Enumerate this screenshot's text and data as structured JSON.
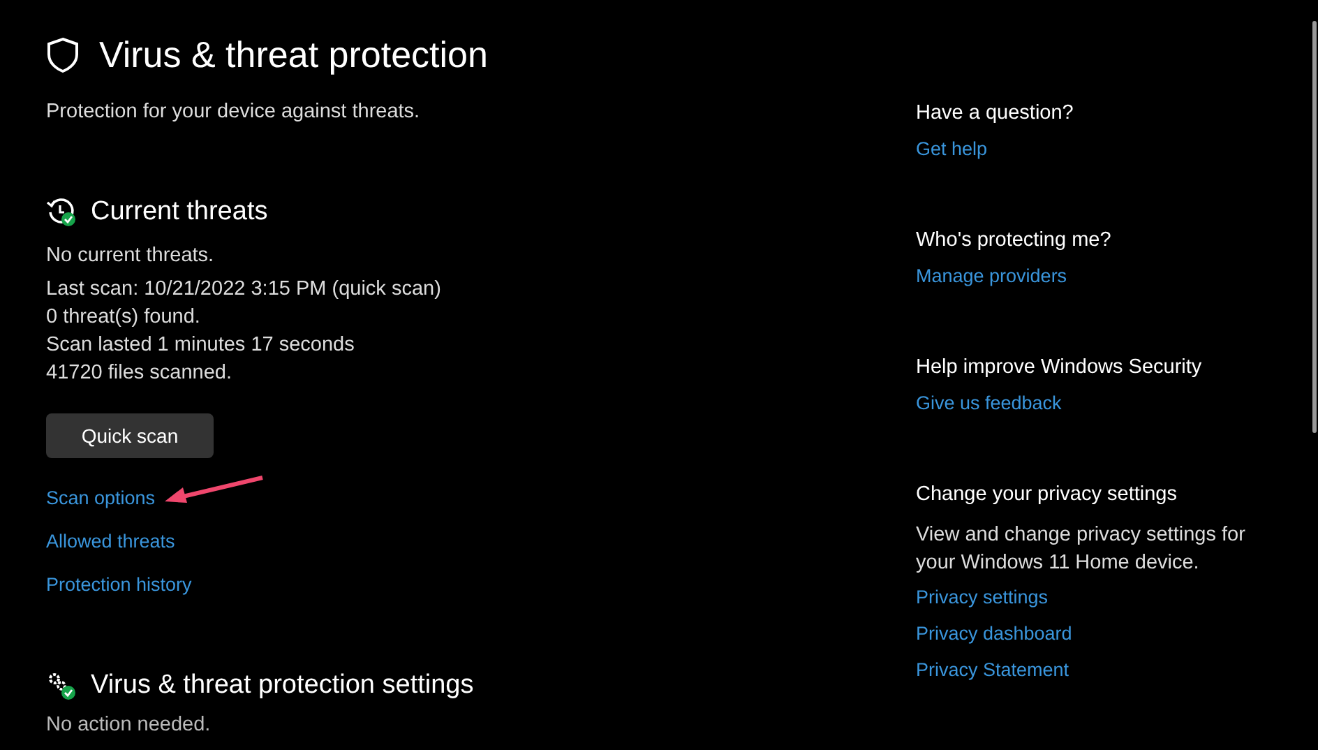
{
  "page": {
    "title": "Virus & threat protection",
    "subtitle": "Protection for your device against threats."
  },
  "current_threats": {
    "heading": "Current threats",
    "lines": [
      "No current threats.",
      "Last scan: 10/21/2022 3:15 PM (quick scan)",
      "0 threat(s) found.",
      "Scan lasted 1 minutes 17 seconds",
      "41720 files scanned."
    ],
    "button": "Quick scan",
    "links": [
      "Scan options",
      "Allowed threats",
      "Protection history"
    ]
  },
  "settings": {
    "heading": "Virus & threat protection settings",
    "status": "No action needed."
  },
  "sidebar": [
    {
      "heading": "Have a question?",
      "links": [
        "Get help"
      ]
    },
    {
      "heading": "Who's protecting me?",
      "links": [
        "Manage providers"
      ]
    },
    {
      "heading": "Help improve Windows Security",
      "links": [
        "Give us feedback"
      ]
    },
    {
      "heading": "Change your privacy settings",
      "text": "View and change privacy settings for your Windows 11 Home device.",
      "links": [
        "Privacy settings",
        "Privacy dashboard",
        "Privacy Statement"
      ]
    }
  ]
}
